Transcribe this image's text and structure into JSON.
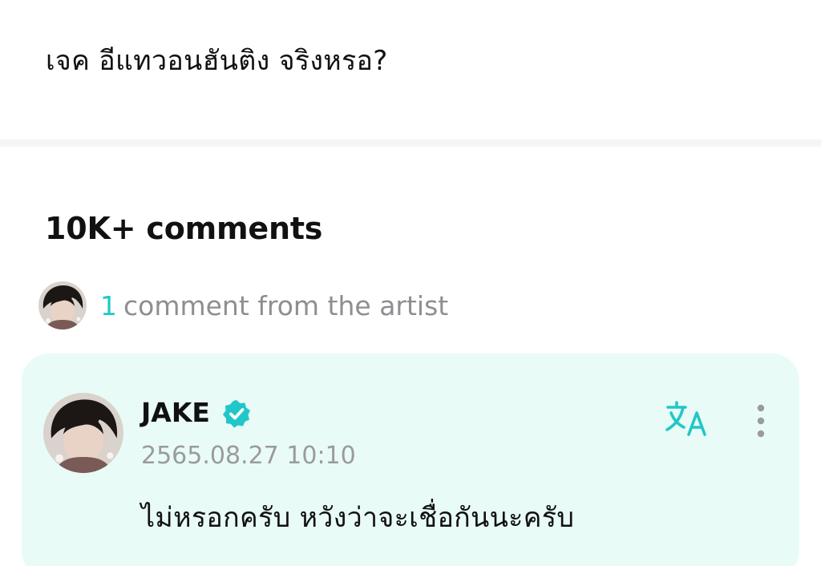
{
  "post": {
    "body": "เจค อีแทวอนฮันติง จริงหรอ?"
  },
  "comments": {
    "count_label": "10K+ comments",
    "artist_summary": {
      "count": "1",
      "label": "comment from the artist"
    },
    "items": [
      {
        "author": "JAKE",
        "verified": true,
        "timestamp": "2565.08.27 10:10",
        "text": "ไม่หรอกครับ หวังว่าจะเชื่อกันนะครับ",
        "background": "#e8fbf7"
      }
    ]
  },
  "icons": {
    "verified": "verified-check-icon",
    "translate": "translate-icon",
    "more": "more-vertical-icon"
  },
  "colors": {
    "accent": "#21c7c8",
    "card_background": "#e8fbf7",
    "muted_text": "#8e8e93"
  }
}
